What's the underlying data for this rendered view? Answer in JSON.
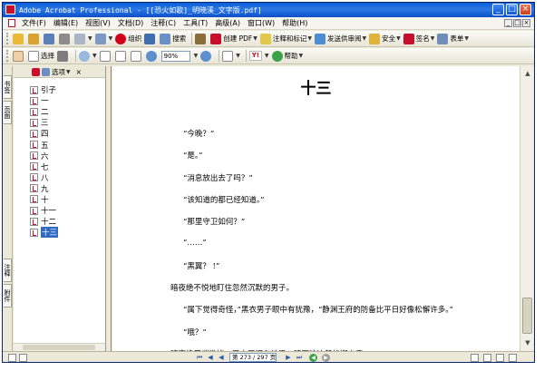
{
  "window": {
    "title": "Adobe Acrobat Professional - [[恐火如歌]_明晓溪_文字版.pdf]",
    "controls": [
      "_",
      "□",
      "×"
    ]
  },
  "menubar": {
    "items": [
      "文件(F)",
      "编辑(E)",
      "视图(V)",
      "文档(D)",
      "注释(C)",
      "工具(T)",
      "高级(A)",
      "窗口(W)",
      "帮助(H)"
    ]
  },
  "toolbar1": {
    "organizer": "组织",
    "search": "搜索",
    "create_pdf": "创建 PDF",
    "comment_markup": "注释和标记",
    "send_review": "发送供审阅",
    "secure": "安全",
    "sign": "签名",
    "forms": "表单"
  },
  "toolbar2": {
    "select": "选择",
    "zoom": "90%",
    "help": "帮助"
  },
  "navtabs": [
    "书签",
    "页面",
    "注释",
    "附件"
  ],
  "bookmarks": {
    "options_label": "选项",
    "items": [
      {
        "label": "引子",
        "selected": false
      },
      {
        "label": "一",
        "selected": false
      },
      {
        "label": "二",
        "selected": false
      },
      {
        "label": "三",
        "selected": false
      },
      {
        "label": "四",
        "selected": false
      },
      {
        "label": "五",
        "selected": false
      },
      {
        "label": "六",
        "selected": false
      },
      {
        "label": "七",
        "selected": false
      },
      {
        "label": "八",
        "selected": false
      },
      {
        "label": "九",
        "selected": false
      },
      {
        "label": "十",
        "selected": false
      },
      {
        "label": "十一",
        "selected": false
      },
      {
        "label": "十二",
        "selected": false
      },
      {
        "label": "十三",
        "selected": true
      }
    ]
  },
  "document": {
    "heading": "十三",
    "lines": [
      {
        "text": "“今晚？”",
        "indent": true
      },
      {
        "text": "“是。”",
        "indent": true
      },
      {
        "text": "“消息放出去了吗？”",
        "indent": true
      },
      {
        "text": "“该知道的都已经知道。”",
        "indent": true
      },
      {
        "text": "“那里守卫如何？”",
        "indent": true
      },
      {
        "text": "“……”",
        "indent": true
      },
      {
        "text": "“黑翼？ !”",
        "indent": true
      },
      {
        "text": "暗夜绝不悦地盯住忽然沉默的男子。",
        "indent": false
      },
      {
        "text": "“属下觉得奇怪，”黑衣男子眼中有犹豫，“静渊王府的防备比平日好像松懈许多。”",
        "indent": true
      },
      {
        "text": "“哦？”",
        "indent": true
      },
      {
        "text": "暗夜绝眉梢微挑，黑衣天问有结果，暗不该这般松懈大意。",
        "indent": false
      }
    ]
  },
  "statusbar": {
    "page_indicator": "第 273 / 297 页"
  }
}
